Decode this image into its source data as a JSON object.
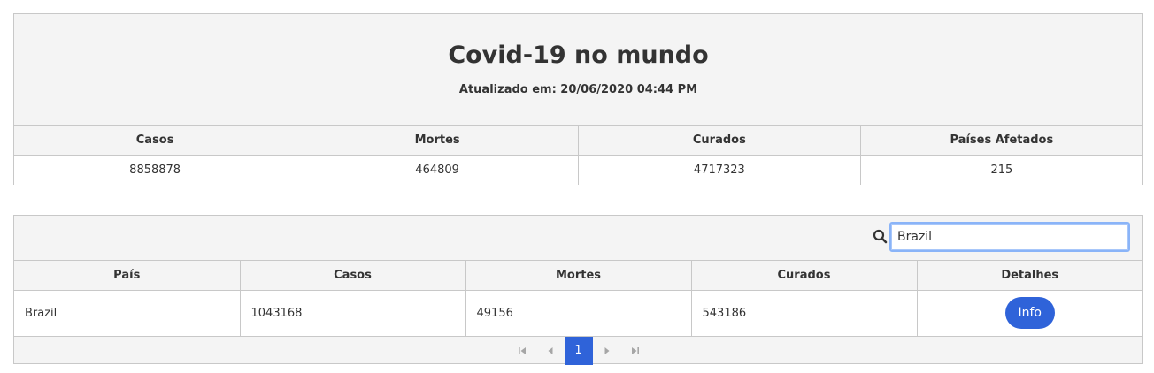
{
  "summary": {
    "title": "Covid-19 no mundo",
    "updated": "Atualizado em: 20/06/2020 04:44 PM",
    "columns": [
      "Casos",
      "Mortes",
      "Curados",
      "Países Afetados"
    ],
    "values": [
      "8858878",
      "464809",
      "4717323",
      "215"
    ]
  },
  "countries": {
    "search": {
      "value": "Brazil",
      "icon": "search-icon"
    },
    "columns": [
      "País",
      "Casos",
      "Mortes",
      "Curados",
      "Detalhes"
    ],
    "rows": [
      {
        "country": "Brazil",
        "cases": "1043168",
        "deaths": "49156",
        "recovered": "543186",
        "details_label": "Info"
      }
    ],
    "paginator": {
      "current_page": "1",
      "icons": [
        "first-page-icon",
        "prev-page-icon",
        "next-page-icon",
        "last-page-icon"
      ]
    }
  },
  "colors": {
    "accent": "#2f63d9",
    "panel_bg": "#f4f4f4",
    "border": "#c8c8c8"
  }
}
